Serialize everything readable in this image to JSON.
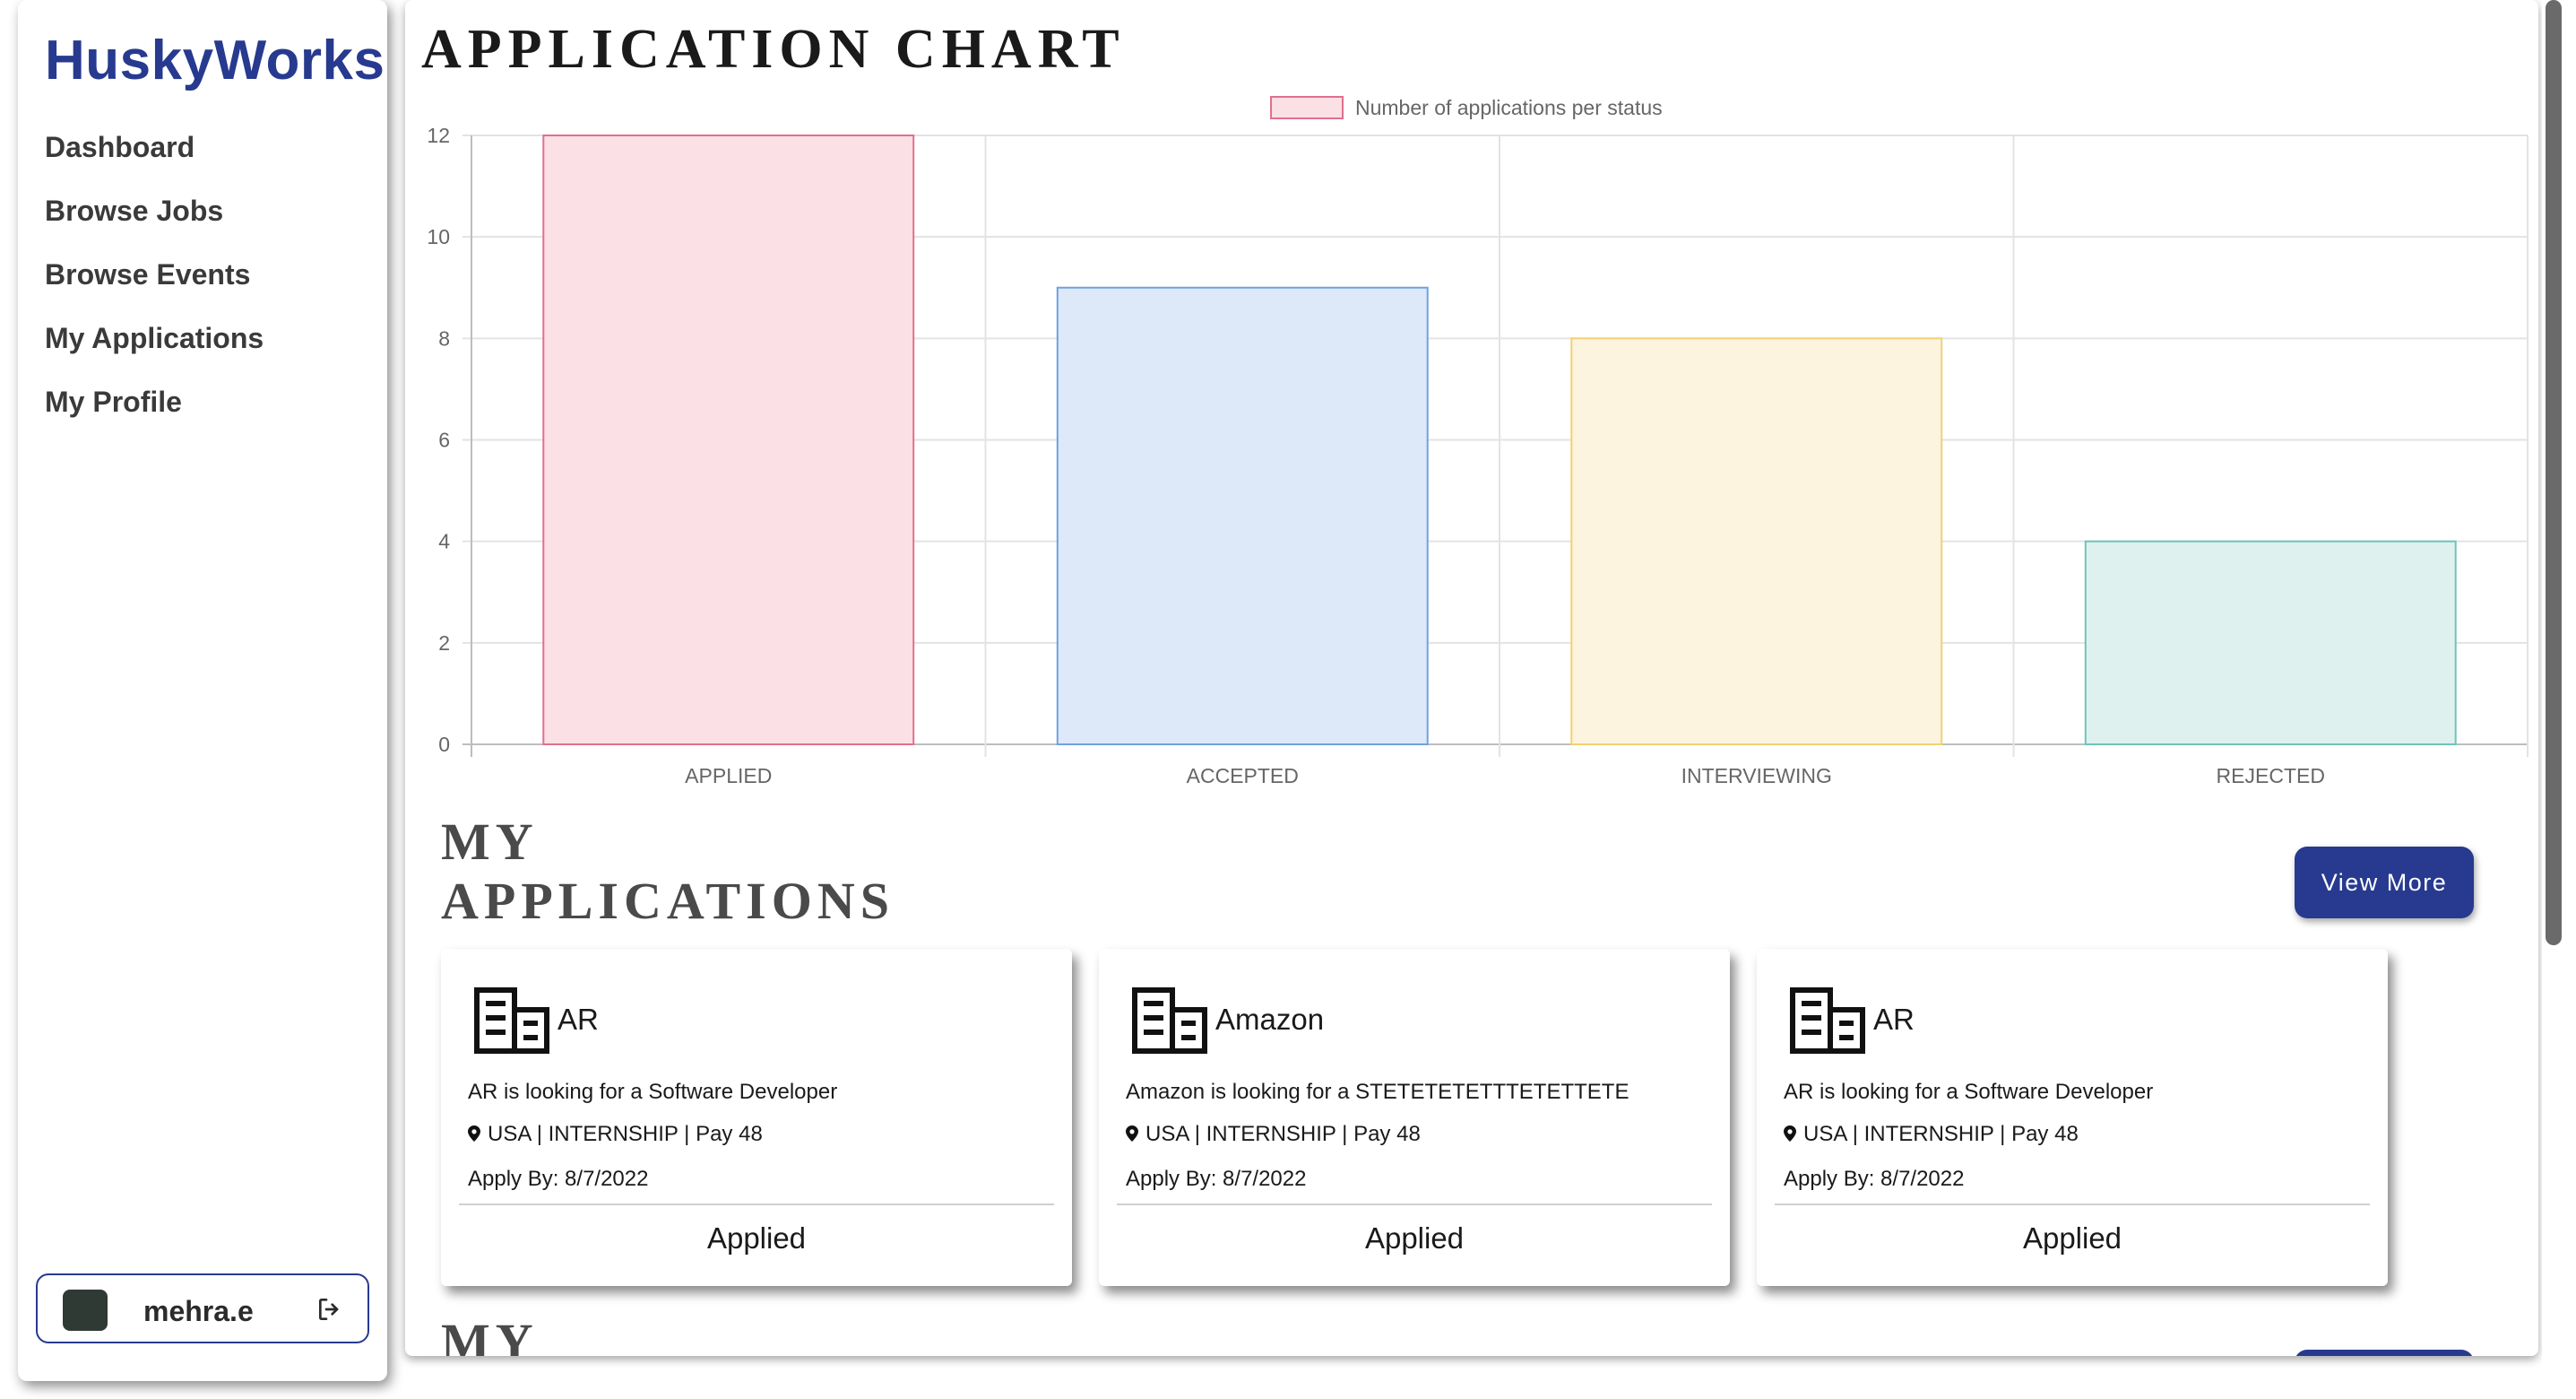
{
  "sidebar": {
    "brand": "HuskyWorks",
    "items": [
      {
        "label": "Dashboard"
      },
      {
        "label": "Browse Jobs"
      },
      {
        "label": "Browse Events"
      },
      {
        "label": "My Applications"
      },
      {
        "label": "My Profile"
      }
    ],
    "user": {
      "name": "mehra.e",
      "logout_icon": "logout-icon"
    }
  },
  "main": {
    "chart_title": "APPLICATION CHART",
    "applications": {
      "title_line1": "MY",
      "title_line2": "APPLICATIONS",
      "view_more_label": "View More",
      "cards": [
        {
          "company": "AR",
          "description": "AR is looking for a Software Developer",
          "location_info": "USA | INTERNSHIP | Pay 48",
          "apply_by": "Apply By: 8/7/2022",
          "status": "Applied"
        },
        {
          "company": "Amazon",
          "description": "Amazon is looking for a STETETETETTTETETTETE",
          "location_info": "USA | INTERNSHIP | Pay 48",
          "apply_by": "Apply By: 8/7/2022",
          "status": "Applied"
        },
        {
          "company": "AR",
          "description": "AR is looking for a Software Developer",
          "location_info": "USA | INTERNSHIP | Pay 48",
          "apply_by": "Apply By: 8/7/2022",
          "status": "Applied"
        }
      ]
    },
    "next_section_title": "MY"
  },
  "colors": {
    "brand": "#273a8f",
    "bar_fills": [
      "#fbe0e6",
      "#dde9f8",
      "#fdf4df",
      "#dff1ef"
    ],
    "bar_strokes": [
      "#e0708c",
      "#6ea2e0",
      "#f2d172",
      "#6dc4b6"
    ]
  },
  "chart_data": {
    "type": "bar",
    "categories": [
      "APPLIED",
      "ACCEPTED",
      "INTERVIEWING",
      "REJECTED"
    ],
    "series": [
      {
        "name": "Number of applications per status",
        "values": [
          12,
          9,
          8,
          4
        ]
      }
    ],
    "ylim": [
      0,
      12
    ],
    "yticks": [
      0,
      2,
      4,
      6,
      8,
      10,
      12
    ],
    "grid": true,
    "legend": "top-center"
  }
}
